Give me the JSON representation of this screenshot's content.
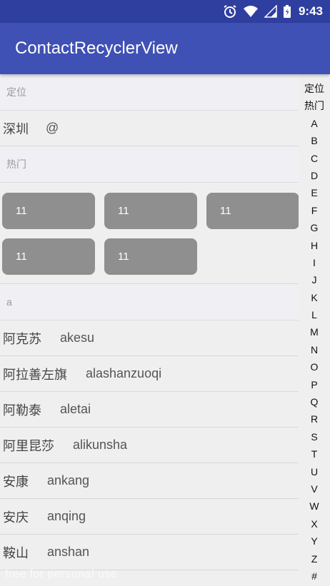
{
  "status_bar": {
    "time": "9:43"
  },
  "app_bar": {
    "title": "ContactRecyclerView"
  },
  "location_section": {
    "header": "定位",
    "city": "深圳",
    "extra": "@"
  },
  "hot_section": {
    "header": "热门",
    "items": [
      "11",
      "11",
      "11",
      "11",
      "11"
    ]
  },
  "a_section": {
    "header": "a",
    "rows": [
      {
        "name": "阿克苏",
        "pinyin": "akesu"
      },
      {
        "name": "阿拉善左旗",
        "pinyin": "alashanzuoqi"
      },
      {
        "name": "阿勒泰",
        "pinyin": "aletai"
      },
      {
        "name": "阿里昆莎",
        "pinyin": "alikunsha"
      },
      {
        "name": "安康",
        "pinyin": "ankang"
      },
      {
        "name": "安庆",
        "pinyin": "anqing"
      },
      {
        "name": "鞍山",
        "pinyin": "anshan"
      }
    ]
  },
  "side_index": [
    "定位",
    "热门",
    "A",
    "B",
    "C",
    "D",
    "E",
    "F",
    "G",
    "H",
    "I",
    "J",
    "K",
    "L",
    "M",
    "N",
    "O",
    "P",
    "Q",
    "R",
    "S",
    "T",
    "U",
    "V",
    "W",
    "X",
    "Y",
    "Z",
    "#"
  ],
  "watermark": "free for personal use",
  "colors": {
    "primary": "#3f51b5",
    "primary_dark": "#2f3f9f",
    "chip": "#8f8f8f"
  }
}
